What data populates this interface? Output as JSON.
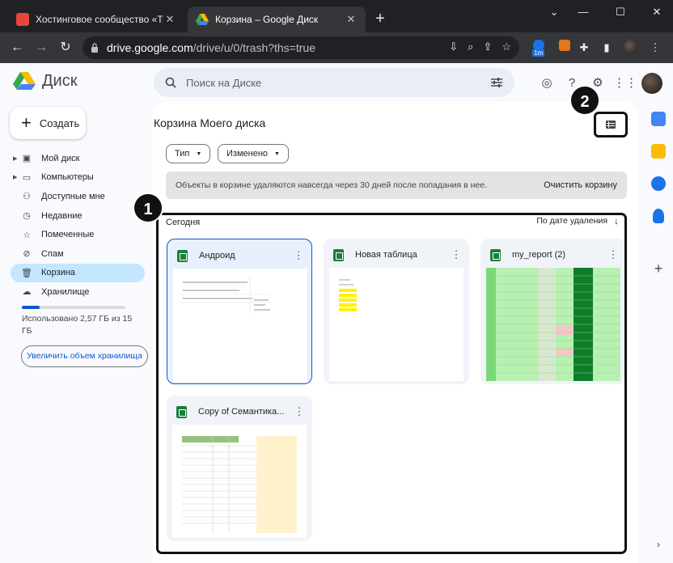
{
  "browser": {
    "tabs": [
      {
        "title": "Хостинговое сообщество «Time",
        "close": "✕"
      },
      {
        "title": "Корзина – Google Диск",
        "close": "✕"
      }
    ],
    "new_tab": "+",
    "window": {
      "minimize": "—",
      "maximize": "☐",
      "close": "✕"
    },
    "url": {
      "host": "drive.google.com",
      "path": "/drive/u/0/trash?ths=true"
    },
    "ext_badge": "1m"
  },
  "header": {
    "app_name": "Диск",
    "search_placeholder": "Поиск на Диске"
  },
  "sidebar": {
    "create_label": "Создать",
    "items": [
      {
        "label": "Мой диск",
        "icon": "my-drive-icon"
      },
      {
        "label": "Компьютеры",
        "icon": "computers-icon"
      },
      {
        "label": "Доступные мне",
        "icon": "shared-icon"
      },
      {
        "label": "Недавние",
        "icon": "clock-icon"
      },
      {
        "label": "Помеченные",
        "icon": "star-icon"
      },
      {
        "label": "Спам",
        "icon": "spam-icon"
      },
      {
        "label": "Корзина",
        "icon": "trash-icon"
      },
      {
        "label": "Хранилище",
        "icon": "cloud-icon"
      }
    ],
    "storage_used_fraction": 0.17,
    "storage_text": "Использовано 2,57 ГБ из 15 ГБ",
    "upgrade_label": "Увеличить объем хранилища"
  },
  "main": {
    "title": "Корзина Моего диска",
    "filters": {
      "type": "Тип",
      "modified": "Изменено"
    },
    "banner_text": "Объекты в корзине удаляются навсегда через 30 дней после попадания в нее.",
    "empty_trash": "Очистить корзину",
    "section_label": "Сегодня",
    "sort_label": "По дате удаления",
    "files": [
      {
        "name": "Андроид"
      },
      {
        "name": "Новая таблица"
      },
      {
        "name": "my_report (2)"
      },
      {
        "name": "Copy of Семантика..."
      }
    ]
  },
  "markers": [
    "1",
    "2"
  ],
  "colors": {
    "accent": "#0b57d0",
    "selected_nav": "#c2e7ff",
    "sheets_green": "#188038"
  }
}
